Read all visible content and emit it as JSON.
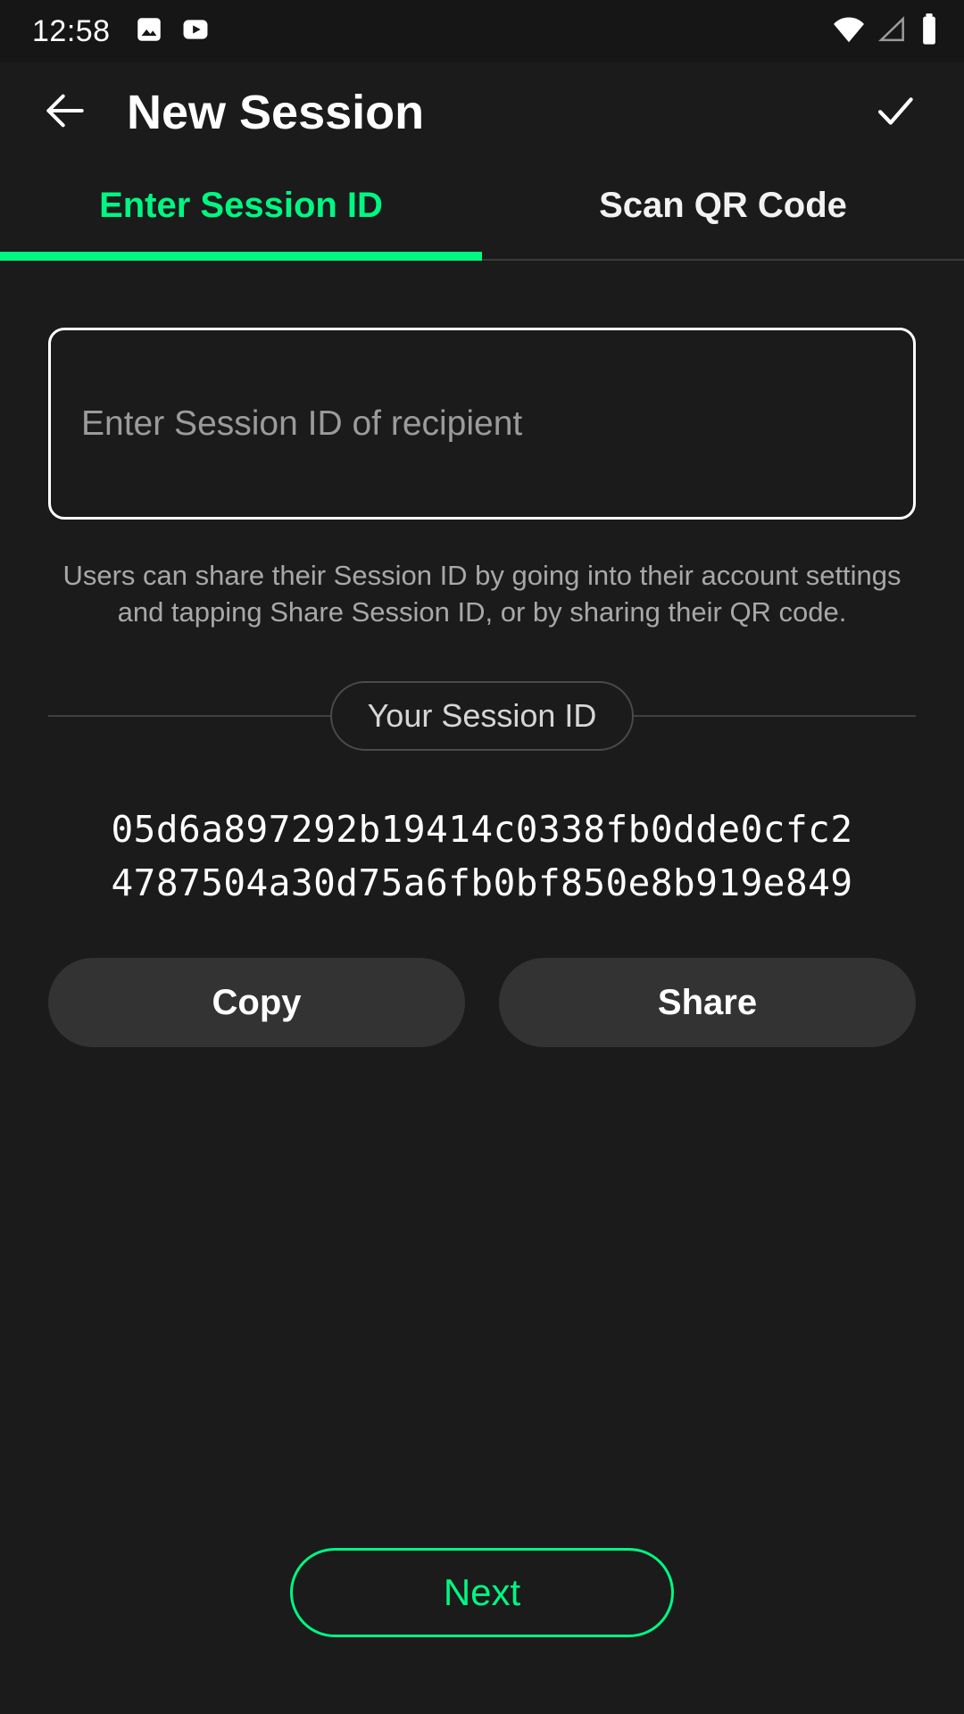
{
  "theme": {
    "background": "#1b1b1b",
    "status_bar_background": "#161616",
    "accent": "#00f782",
    "text_primary": "#ffffff",
    "text_secondary": "#a8a8a8",
    "button_surface": "#333333"
  },
  "status_bar": {
    "time": "12:58",
    "left_icons": [
      "gallery-icon",
      "youtube-icon"
    ],
    "right_icons": [
      "wifi-icon",
      "cellular-signal-icon",
      "battery-icon"
    ]
  },
  "app_bar": {
    "back_icon": "back-arrow-icon",
    "title": "New Session",
    "confirm_icon": "check-icon"
  },
  "tabs": {
    "active_index": 0,
    "items": [
      {
        "label": "Enter Session ID"
      },
      {
        "label": "Scan QR Code"
      }
    ]
  },
  "main": {
    "session_id_input": {
      "value": "",
      "placeholder": "Enter Session ID of recipient"
    },
    "helper_text": "Users can share their Session ID by going into their account settings and tapping Share Session ID, or by sharing their QR code.",
    "divider_label": "Your Session ID",
    "your_session_id": {
      "line1": "05d6a897292b19414c0338fb0dde0cfc2",
      "line2": "4787504a30d75a6fb0bf850e8b919e849",
      "full": "05d6a897292b19414c0338fb0dde0cfc24787504a30d75a6fb0bf850e8b919e849"
    },
    "copy_label": "Copy",
    "share_label": "Share"
  },
  "footer": {
    "next_label": "Next"
  }
}
